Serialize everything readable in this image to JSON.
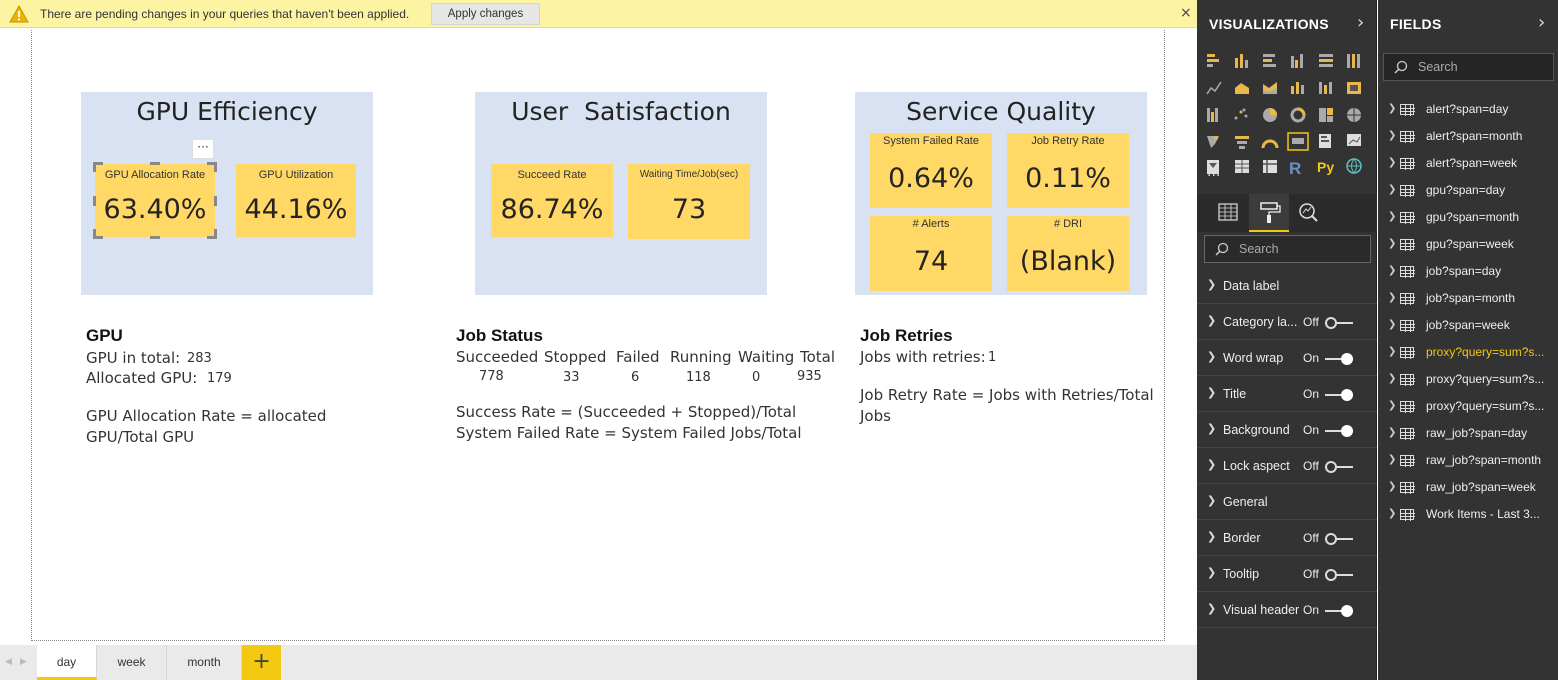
{
  "notification": {
    "message": "There are pending changes in your queries that haven't been applied.",
    "apply_label": "Apply changes",
    "close_glyph": "×"
  },
  "canvas": {
    "gpu_efficiency": {
      "title": "GPU Efficiency",
      "more_glyph": "···",
      "cards": [
        {
          "label": "GPU Allocation Rate",
          "value": "63.40%"
        },
        {
          "label": "GPU Utilization",
          "value": "44.16%"
        }
      ]
    },
    "user_satisfaction": {
      "title": "User  Satisfaction",
      "cards": [
        {
          "label": "Succeed Rate",
          "value": "86.74%"
        },
        {
          "label": "Waiting Time/Job(sec)",
          "value": "73"
        }
      ]
    },
    "service_quality": {
      "title": "Service Quality",
      "cards": [
        {
          "label": "System Failed Rate",
          "value": "0.64%"
        },
        {
          "label": "Job Retry Rate",
          "value": "0.11%"
        },
        {
          "label": "# Alerts",
          "value": "74"
        },
        {
          "label": "# DRI",
          "value": "(Blank)"
        }
      ]
    },
    "gpu_section": {
      "title": "GPU",
      "total_label": "GPU in total:",
      "total_value": "283",
      "allocated_label": "Allocated GPU:",
      "allocated_value": "179",
      "formula_line1": "GPU Allocation Rate = allocated",
      "formula_line2": "GPU/Total GPU"
    },
    "job_status": {
      "title": "Job Status",
      "headers": [
        "Succeeded",
        "Stopped",
        "Failed",
        "Running",
        "Waiting",
        "Total"
      ],
      "values": [
        "778",
        "33",
        "6",
        "118",
        "0",
        "935"
      ],
      "formula_line1": "Success Rate = (Succeeded + Stopped)/Total",
      "formula_line2": "System Failed Rate = System Failed Jobs/Total"
    },
    "job_retries": {
      "title": "Job Retries",
      "retries_label": "Jobs with retries:",
      "retries_value": "1",
      "formula_line1": "Job Retry Rate = Jobs with Retries/Total",
      "formula_line2": "Jobs"
    }
  },
  "page_tabs": {
    "tabs": [
      "day",
      "week",
      "month"
    ],
    "active": "day",
    "add_glyph": "+"
  },
  "visualizations": {
    "title": "VISUALIZATIONS",
    "more_glyph": "···",
    "r_label": "R",
    "py_label": "Py",
    "search_placeholder": "Search",
    "format_rows": [
      {
        "label": "Data label",
        "state": ""
      },
      {
        "label": "Category la...",
        "state": "Off"
      },
      {
        "label": "Word wrap",
        "state": "On"
      },
      {
        "label": "Title",
        "state": "On"
      },
      {
        "label": "Background",
        "state": "On"
      },
      {
        "label": "Lock aspect",
        "state": "Off"
      },
      {
        "label": "General",
        "state": ""
      },
      {
        "label": "Border",
        "state": "Off"
      },
      {
        "label": "Tooltip",
        "state": "Off"
      },
      {
        "label": "Visual header",
        "state": "On"
      }
    ]
  },
  "fields": {
    "title": "FIELDS",
    "search_placeholder": "Search",
    "items": [
      "alert?span=day",
      "alert?span=month",
      "alert?span=week",
      "gpu?span=day",
      "gpu?span=month",
      "gpu?span=week",
      "job?span=day",
      "job?span=month",
      "job?span=week",
      "proxy?query=sum?s...",
      "proxy?query=sum?s...",
      "proxy?query=sum?s...",
      "raw_job?span=day",
      "raw_job?span=month",
      "raw_job?span=week",
      "Work Items - Last 3..."
    ],
    "highlighted_index": 9
  },
  "colors": {
    "accent": "#f2c811",
    "card": "#ffd866",
    "panel": "#d9e2f3",
    "pane": "#333333",
    "notification": "#fcf4a3"
  }
}
